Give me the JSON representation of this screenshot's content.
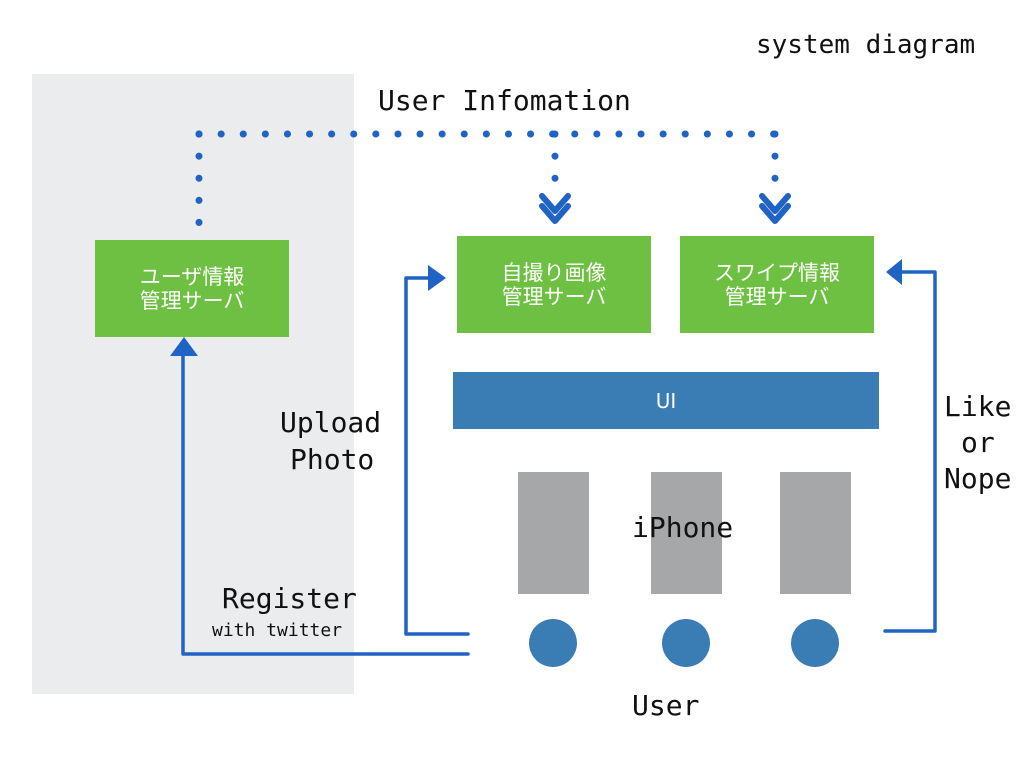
{
  "title": "system diagram",
  "labels": {
    "user_information": "User Infomation",
    "upload": "Upload",
    "photo": "Photo",
    "register": "Register",
    "with_twitter": "with twitter",
    "like": "Like",
    "or": "or",
    "nope": "Nope",
    "iphone": "iPhone",
    "user": "User"
  },
  "servers": {
    "user_info": {
      "line1": "ユーザ情報",
      "line2": "管理サーバ"
    },
    "selfie": {
      "line1": "自撮り画像",
      "line2": "管理サーバ"
    },
    "swipe": {
      "line1": "スワイプ情報",
      "line2": "管理サーバ"
    }
  },
  "ui_bar": {
    "label": "UI"
  },
  "colors": {
    "server_green": "#6ec042",
    "ui_blue": "#3a7cb4",
    "phone_gray": "#a6a7a9",
    "panel_gray": "#ebecee",
    "arrow_blue": "#1f63c4"
  }
}
